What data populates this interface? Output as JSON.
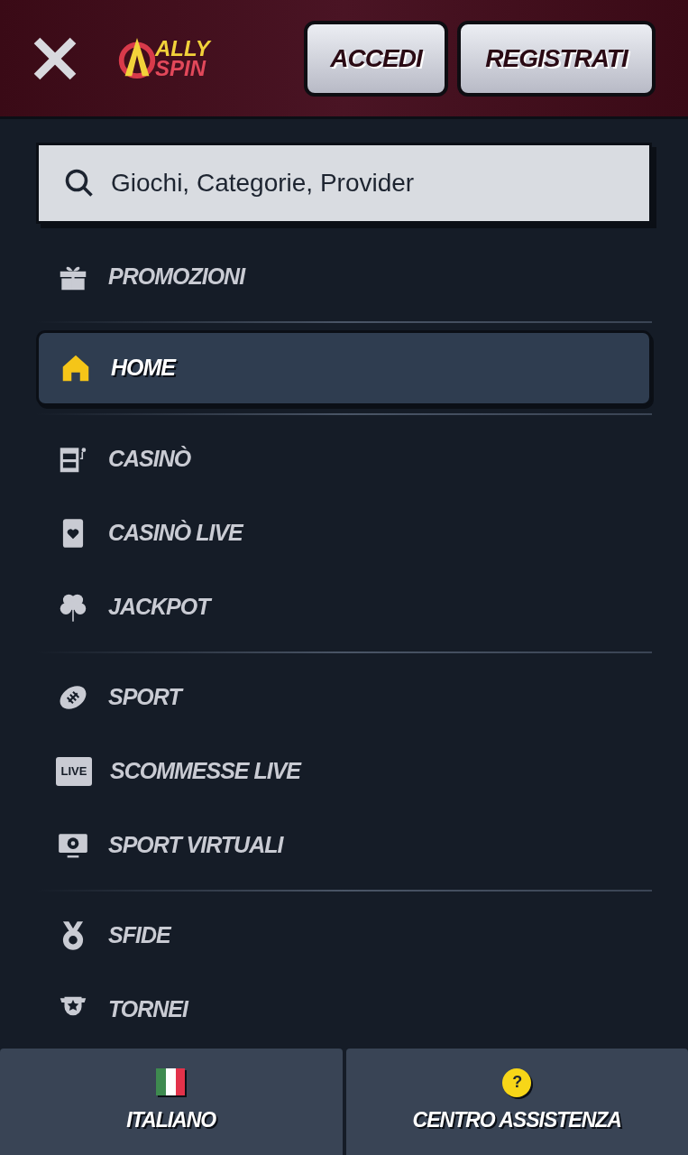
{
  "header": {
    "logo": {
      "top": "ALLY",
      "bottom": "SPIN"
    },
    "buttons": [
      "ACCEDI",
      "REGISTRATI"
    ]
  },
  "search": {
    "placeholder": "Giochi, Categorie, Provider"
  },
  "menu_groups": [
    {
      "items": [
        {
          "label": "PROMOZIONI",
          "selected": false
        }
      ]
    },
    {
      "items": [
        {
          "label": "HOME",
          "selected": true
        }
      ]
    },
    {
      "items": [
        {
          "label": "CASINÒ",
          "selected": false
        },
        {
          "label": "CASINÒ LIVE",
          "selected": false
        },
        {
          "label": "JACKPOT",
          "selected": false
        }
      ]
    },
    {
      "items": [
        {
          "label": "SPORT",
          "selected": false
        },
        {
          "label": "SCOMMESSE LIVE",
          "selected": false,
          "icon_text": "LIVE"
        },
        {
          "label": "SPORT VIRTUALI",
          "selected": false
        }
      ]
    },
    {
      "items": [
        {
          "label": "SFIDE",
          "selected": false
        },
        {
          "label": "TORNEI",
          "selected": false
        }
      ]
    }
  ],
  "footer": [
    {
      "label": "ITALIANO"
    },
    {
      "label": "CENTRO ASSISTENZA",
      "icon_text": "?"
    }
  ]
}
